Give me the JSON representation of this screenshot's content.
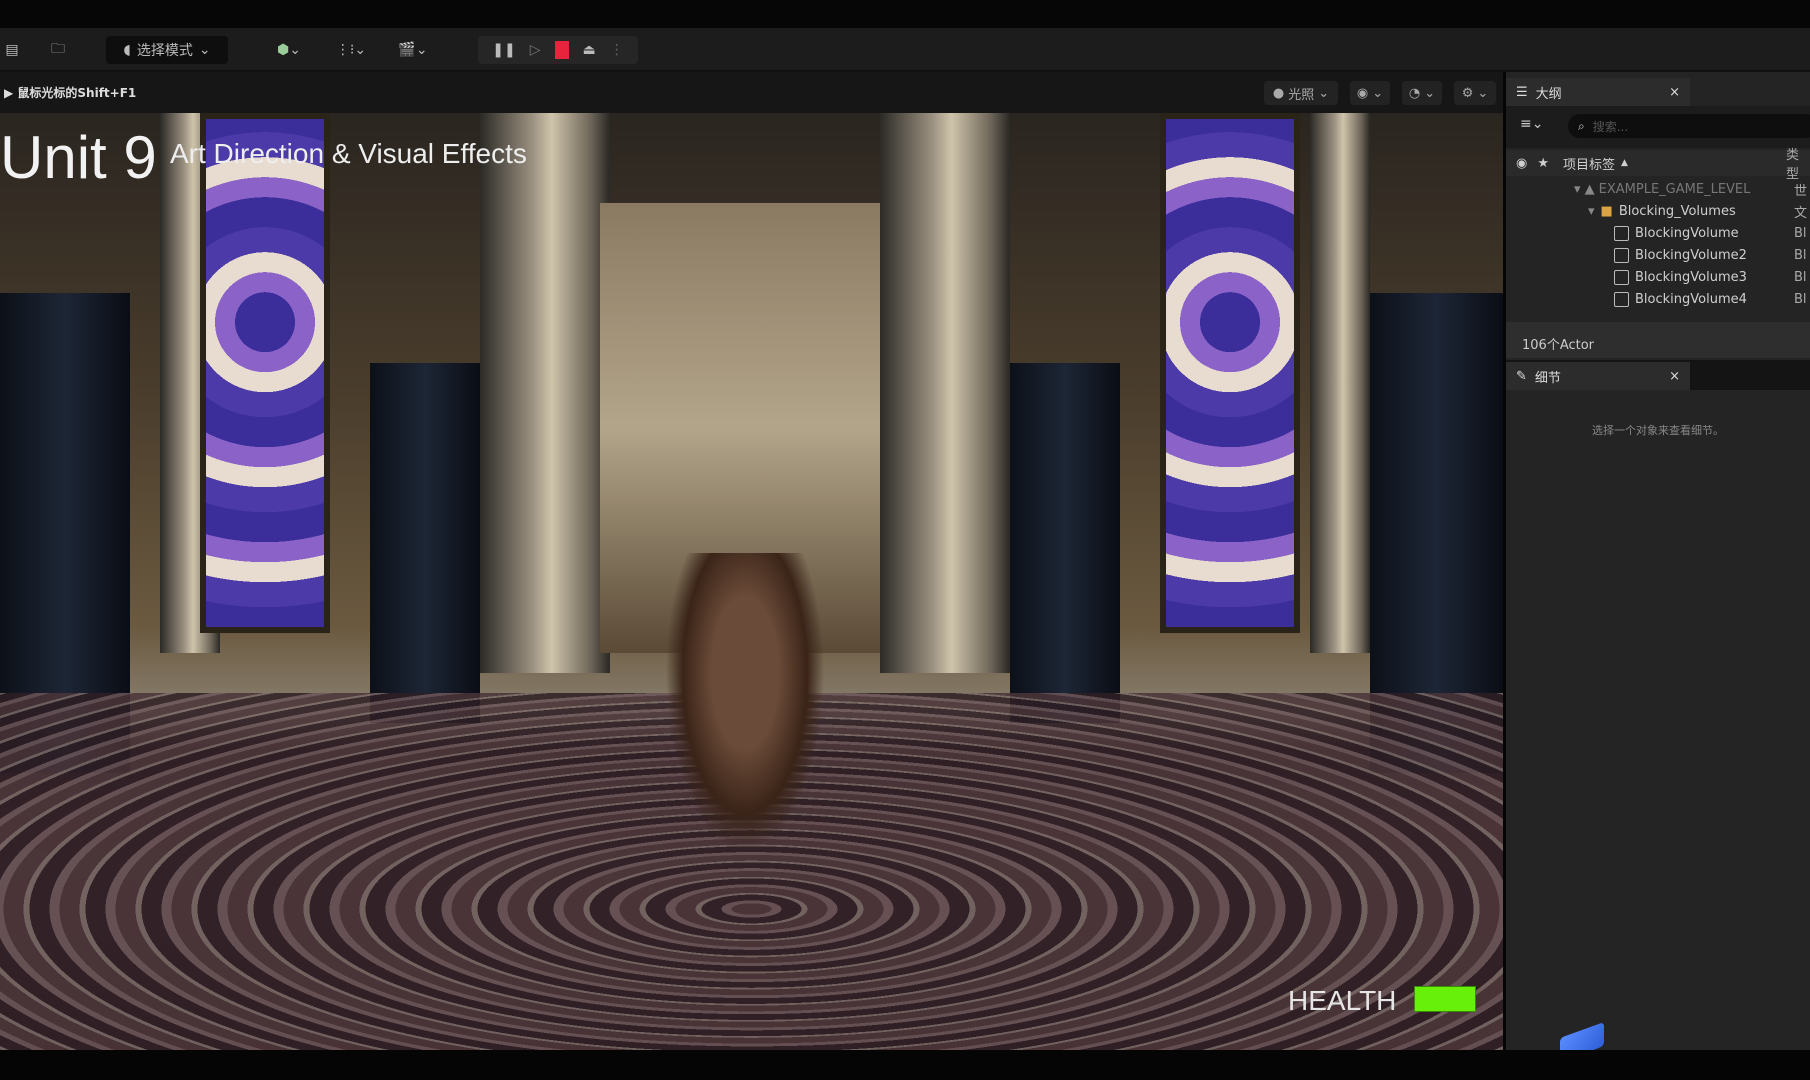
{
  "toolbar": {
    "mode_label": "选择模式"
  },
  "viewport_header": {
    "hint": "鼠标光标的Shift+F1",
    "lighting_label": "光照"
  },
  "hud": {
    "title": "Unit 9",
    "subtitle": "Art Direction & Visual Effects",
    "health_label": "HEALTH",
    "health_fraction": 1.0,
    "health_color": "#66f00a"
  },
  "outliner": {
    "tab_label": "大纲",
    "close": "×",
    "search_placeholder": "搜索...",
    "col_label": "项目标签",
    "col_type": "类型",
    "rows": [
      {
        "label": "EXAMPLE_GAME_LEVEL",
        "type": "世"
      },
      {
        "label": "Blocking_Volumes",
        "type": "文"
      },
      {
        "label": "BlockingVolume",
        "type": "Bl"
      },
      {
        "label": "BlockingVolume2",
        "type": "Bl"
      },
      {
        "label": "BlockingVolume3",
        "type": "Bl"
      },
      {
        "label": "BlockingVolume4",
        "type": "Bl"
      }
    ],
    "footer": "106个Actor"
  },
  "details": {
    "tab_label": "细节",
    "close": "×",
    "empty_text": "选择一个对象来查看细节。"
  }
}
